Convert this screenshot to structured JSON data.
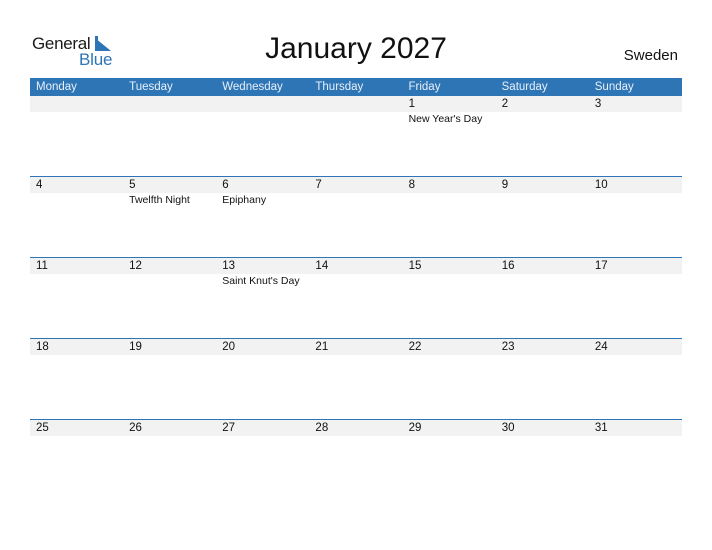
{
  "logo": {
    "line1": "General",
    "line2": "Blue"
  },
  "title": "January 2027",
  "country": "Sweden",
  "colors": {
    "accent": "#2e75b6",
    "row_bg": "#f2f2f2"
  },
  "weekdays": [
    "Monday",
    "Tuesday",
    "Wednesday",
    "Thursday",
    "Friday",
    "Saturday",
    "Sunday"
  ],
  "weeks": [
    [
      {
        "day": "",
        "holiday": ""
      },
      {
        "day": "",
        "holiday": ""
      },
      {
        "day": "",
        "holiday": ""
      },
      {
        "day": "",
        "holiday": ""
      },
      {
        "day": "1",
        "holiday": "New Year's Day"
      },
      {
        "day": "2",
        "holiday": ""
      },
      {
        "day": "3",
        "holiday": ""
      }
    ],
    [
      {
        "day": "4",
        "holiday": ""
      },
      {
        "day": "5",
        "holiday": "Twelfth Night"
      },
      {
        "day": "6",
        "holiday": "Epiphany"
      },
      {
        "day": "7",
        "holiday": ""
      },
      {
        "day": "8",
        "holiday": ""
      },
      {
        "day": "9",
        "holiday": ""
      },
      {
        "day": "10",
        "holiday": ""
      }
    ],
    [
      {
        "day": "11",
        "holiday": ""
      },
      {
        "day": "12",
        "holiday": ""
      },
      {
        "day": "13",
        "holiday": "Saint Knut's Day"
      },
      {
        "day": "14",
        "holiday": ""
      },
      {
        "day": "15",
        "holiday": ""
      },
      {
        "day": "16",
        "holiday": ""
      },
      {
        "day": "17",
        "holiday": ""
      }
    ],
    [
      {
        "day": "18",
        "holiday": ""
      },
      {
        "day": "19",
        "holiday": ""
      },
      {
        "day": "20",
        "holiday": ""
      },
      {
        "day": "21",
        "holiday": ""
      },
      {
        "day": "22",
        "holiday": ""
      },
      {
        "day": "23",
        "holiday": ""
      },
      {
        "day": "24",
        "holiday": ""
      }
    ],
    [
      {
        "day": "25",
        "holiday": ""
      },
      {
        "day": "26",
        "holiday": ""
      },
      {
        "day": "27",
        "holiday": ""
      },
      {
        "day": "28",
        "holiday": ""
      },
      {
        "day": "29",
        "holiday": ""
      },
      {
        "day": "30",
        "holiday": ""
      },
      {
        "day": "31",
        "holiday": ""
      }
    ]
  ]
}
